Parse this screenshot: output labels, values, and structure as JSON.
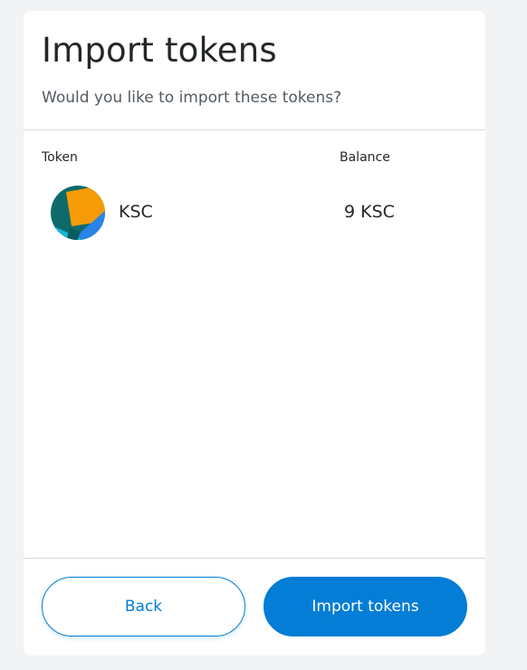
{
  "header": {
    "title": "Import tokens",
    "subtitle": "Would you like to import these tokens?"
  },
  "table": {
    "columns": [
      "Token",
      "Balance"
    ],
    "rows": [
      {
        "icon": "token-jazzicon",
        "symbol": "KSC",
        "balance": "9 KSC"
      }
    ]
  },
  "footer": {
    "back_label": "Back",
    "import_label": "Import tokens"
  },
  "colors": {
    "accent": "#037dd6",
    "text": "#24272a",
    "muted": "#535a61",
    "background": "#f2f3f4",
    "divider": "#d6d9dc"
  }
}
